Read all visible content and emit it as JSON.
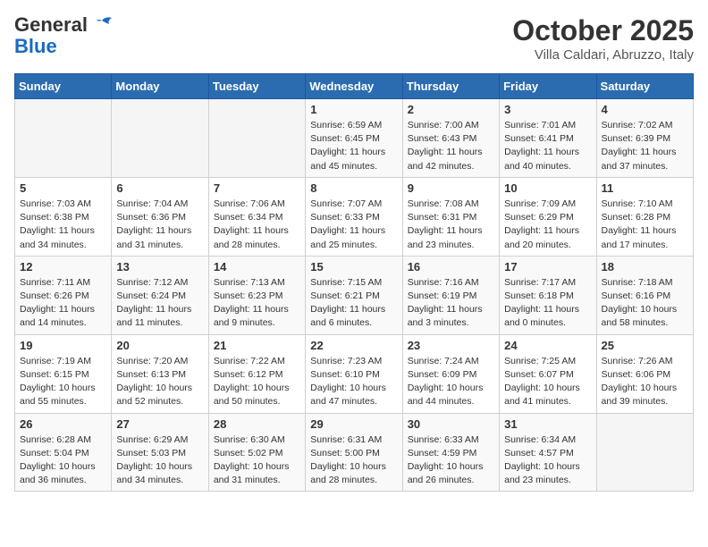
{
  "header": {
    "logo_general": "General",
    "logo_blue": "Blue",
    "month": "October 2025",
    "location": "Villa Caldari, Abruzzo, Italy"
  },
  "weekdays": [
    "Sunday",
    "Monday",
    "Tuesday",
    "Wednesday",
    "Thursday",
    "Friday",
    "Saturday"
  ],
  "weeks": [
    [
      {
        "day": "",
        "info": ""
      },
      {
        "day": "",
        "info": ""
      },
      {
        "day": "",
        "info": ""
      },
      {
        "day": "1",
        "info": "Sunrise: 6:59 AM\nSunset: 6:45 PM\nDaylight: 11 hours and 45 minutes."
      },
      {
        "day": "2",
        "info": "Sunrise: 7:00 AM\nSunset: 6:43 PM\nDaylight: 11 hours and 42 minutes."
      },
      {
        "day": "3",
        "info": "Sunrise: 7:01 AM\nSunset: 6:41 PM\nDaylight: 11 hours and 40 minutes."
      },
      {
        "day": "4",
        "info": "Sunrise: 7:02 AM\nSunset: 6:39 PM\nDaylight: 11 hours and 37 minutes."
      }
    ],
    [
      {
        "day": "5",
        "info": "Sunrise: 7:03 AM\nSunset: 6:38 PM\nDaylight: 11 hours and 34 minutes."
      },
      {
        "day": "6",
        "info": "Sunrise: 7:04 AM\nSunset: 6:36 PM\nDaylight: 11 hours and 31 minutes."
      },
      {
        "day": "7",
        "info": "Sunrise: 7:06 AM\nSunset: 6:34 PM\nDaylight: 11 hours and 28 minutes."
      },
      {
        "day": "8",
        "info": "Sunrise: 7:07 AM\nSunset: 6:33 PM\nDaylight: 11 hours and 25 minutes."
      },
      {
        "day": "9",
        "info": "Sunrise: 7:08 AM\nSunset: 6:31 PM\nDaylight: 11 hours and 23 minutes."
      },
      {
        "day": "10",
        "info": "Sunrise: 7:09 AM\nSunset: 6:29 PM\nDaylight: 11 hours and 20 minutes."
      },
      {
        "day": "11",
        "info": "Sunrise: 7:10 AM\nSunset: 6:28 PM\nDaylight: 11 hours and 17 minutes."
      }
    ],
    [
      {
        "day": "12",
        "info": "Sunrise: 7:11 AM\nSunset: 6:26 PM\nDaylight: 11 hours and 14 minutes."
      },
      {
        "day": "13",
        "info": "Sunrise: 7:12 AM\nSunset: 6:24 PM\nDaylight: 11 hours and 11 minutes."
      },
      {
        "day": "14",
        "info": "Sunrise: 7:13 AM\nSunset: 6:23 PM\nDaylight: 11 hours and 9 minutes."
      },
      {
        "day": "15",
        "info": "Sunrise: 7:15 AM\nSunset: 6:21 PM\nDaylight: 11 hours and 6 minutes."
      },
      {
        "day": "16",
        "info": "Sunrise: 7:16 AM\nSunset: 6:19 PM\nDaylight: 11 hours and 3 minutes."
      },
      {
        "day": "17",
        "info": "Sunrise: 7:17 AM\nSunset: 6:18 PM\nDaylight: 11 hours and 0 minutes."
      },
      {
        "day": "18",
        "info": "Sunrise: 7:18 AM\nSunset: 6:16 PM\nDaylight: 10 hours and 58 minutes."
      }
    ],
    [
      {
        "day": "19",
        "info": "Sunrise: 7:19 AM\nSunset: 6:15 PM\nDaylight: 10 hours and 55 minutes."
      },
      {
        "day": "20",
        "info": "Sunrise: 7:20 AM\nSunset: 6:13 PM\nDaylight: 10 hours and 52 minutes."
      },
      {
        "day": "21",
        "info": "Sunrise: 7:22 AM\nSunset: 6:12 PM\nDaylight: 10 hours and 50 minutes."
      },
      {
        "day": "22",
        "info": "Sunrise: 7:23 AM\nSunset: 6:10 PM\nDaylight: 10 hours and 47 minutes."
      },
      {
        "day": "23",
        "info": "Sunrise: 7:24 AM\nSunset: 6:09 PM\nDaylight: 10 hours and 44 minutes."
      },
      {
        "day": "24",
        "info": "Sunrise: 7:25 AM\nSunset: 6:07 PM\nDaylight: 10 hours and 41 minutes."
      },
      {
        "day": "25",
        "info": "Sunrise: 7:26 AM\nSunset: 6:06 PM\nDaylight: 10 hours and 39 minutes."
      }
    ],
    [
      {
        "day": "26",
        "info": "Sunrise: 6:28 AM\nSunset: 5:04 PM\nDaylight: 10 hours and 36 minutes."
      },
      {
        "day": "27",
        "info": "Sunrise: 6:29 AM\nSunset: 5:03 PM\nDaylight: 10 hours and 34 minutes."
      },
      {
        "day": "28",
        "info": "Sunrise: 6:30 AM\nSunset: 5:02 PM\nDaylight: 10 hours and 31 minutes."
      },
      {
        "day": "29",
        "info": "Sunrise: 6:31 AM\nSunset: 5:00 PM\nDaylight: 10 hours and 28 minutes."
      },
      {
        "day": "30",
        "info": "Sunrise: 6:33 AM\nSunset: 4:59 PM\nDaylight: 10 hours and 26 minutes."
      },
      {
        "day": "31",
        "info": "Sunrise: 6:34 AM\nSunset: 4:57 PM\nDaylight: 10 hours and 23 minutes."
      },
      {
        "day": "",
        "info": ""
      }
    ]
  ]
}
